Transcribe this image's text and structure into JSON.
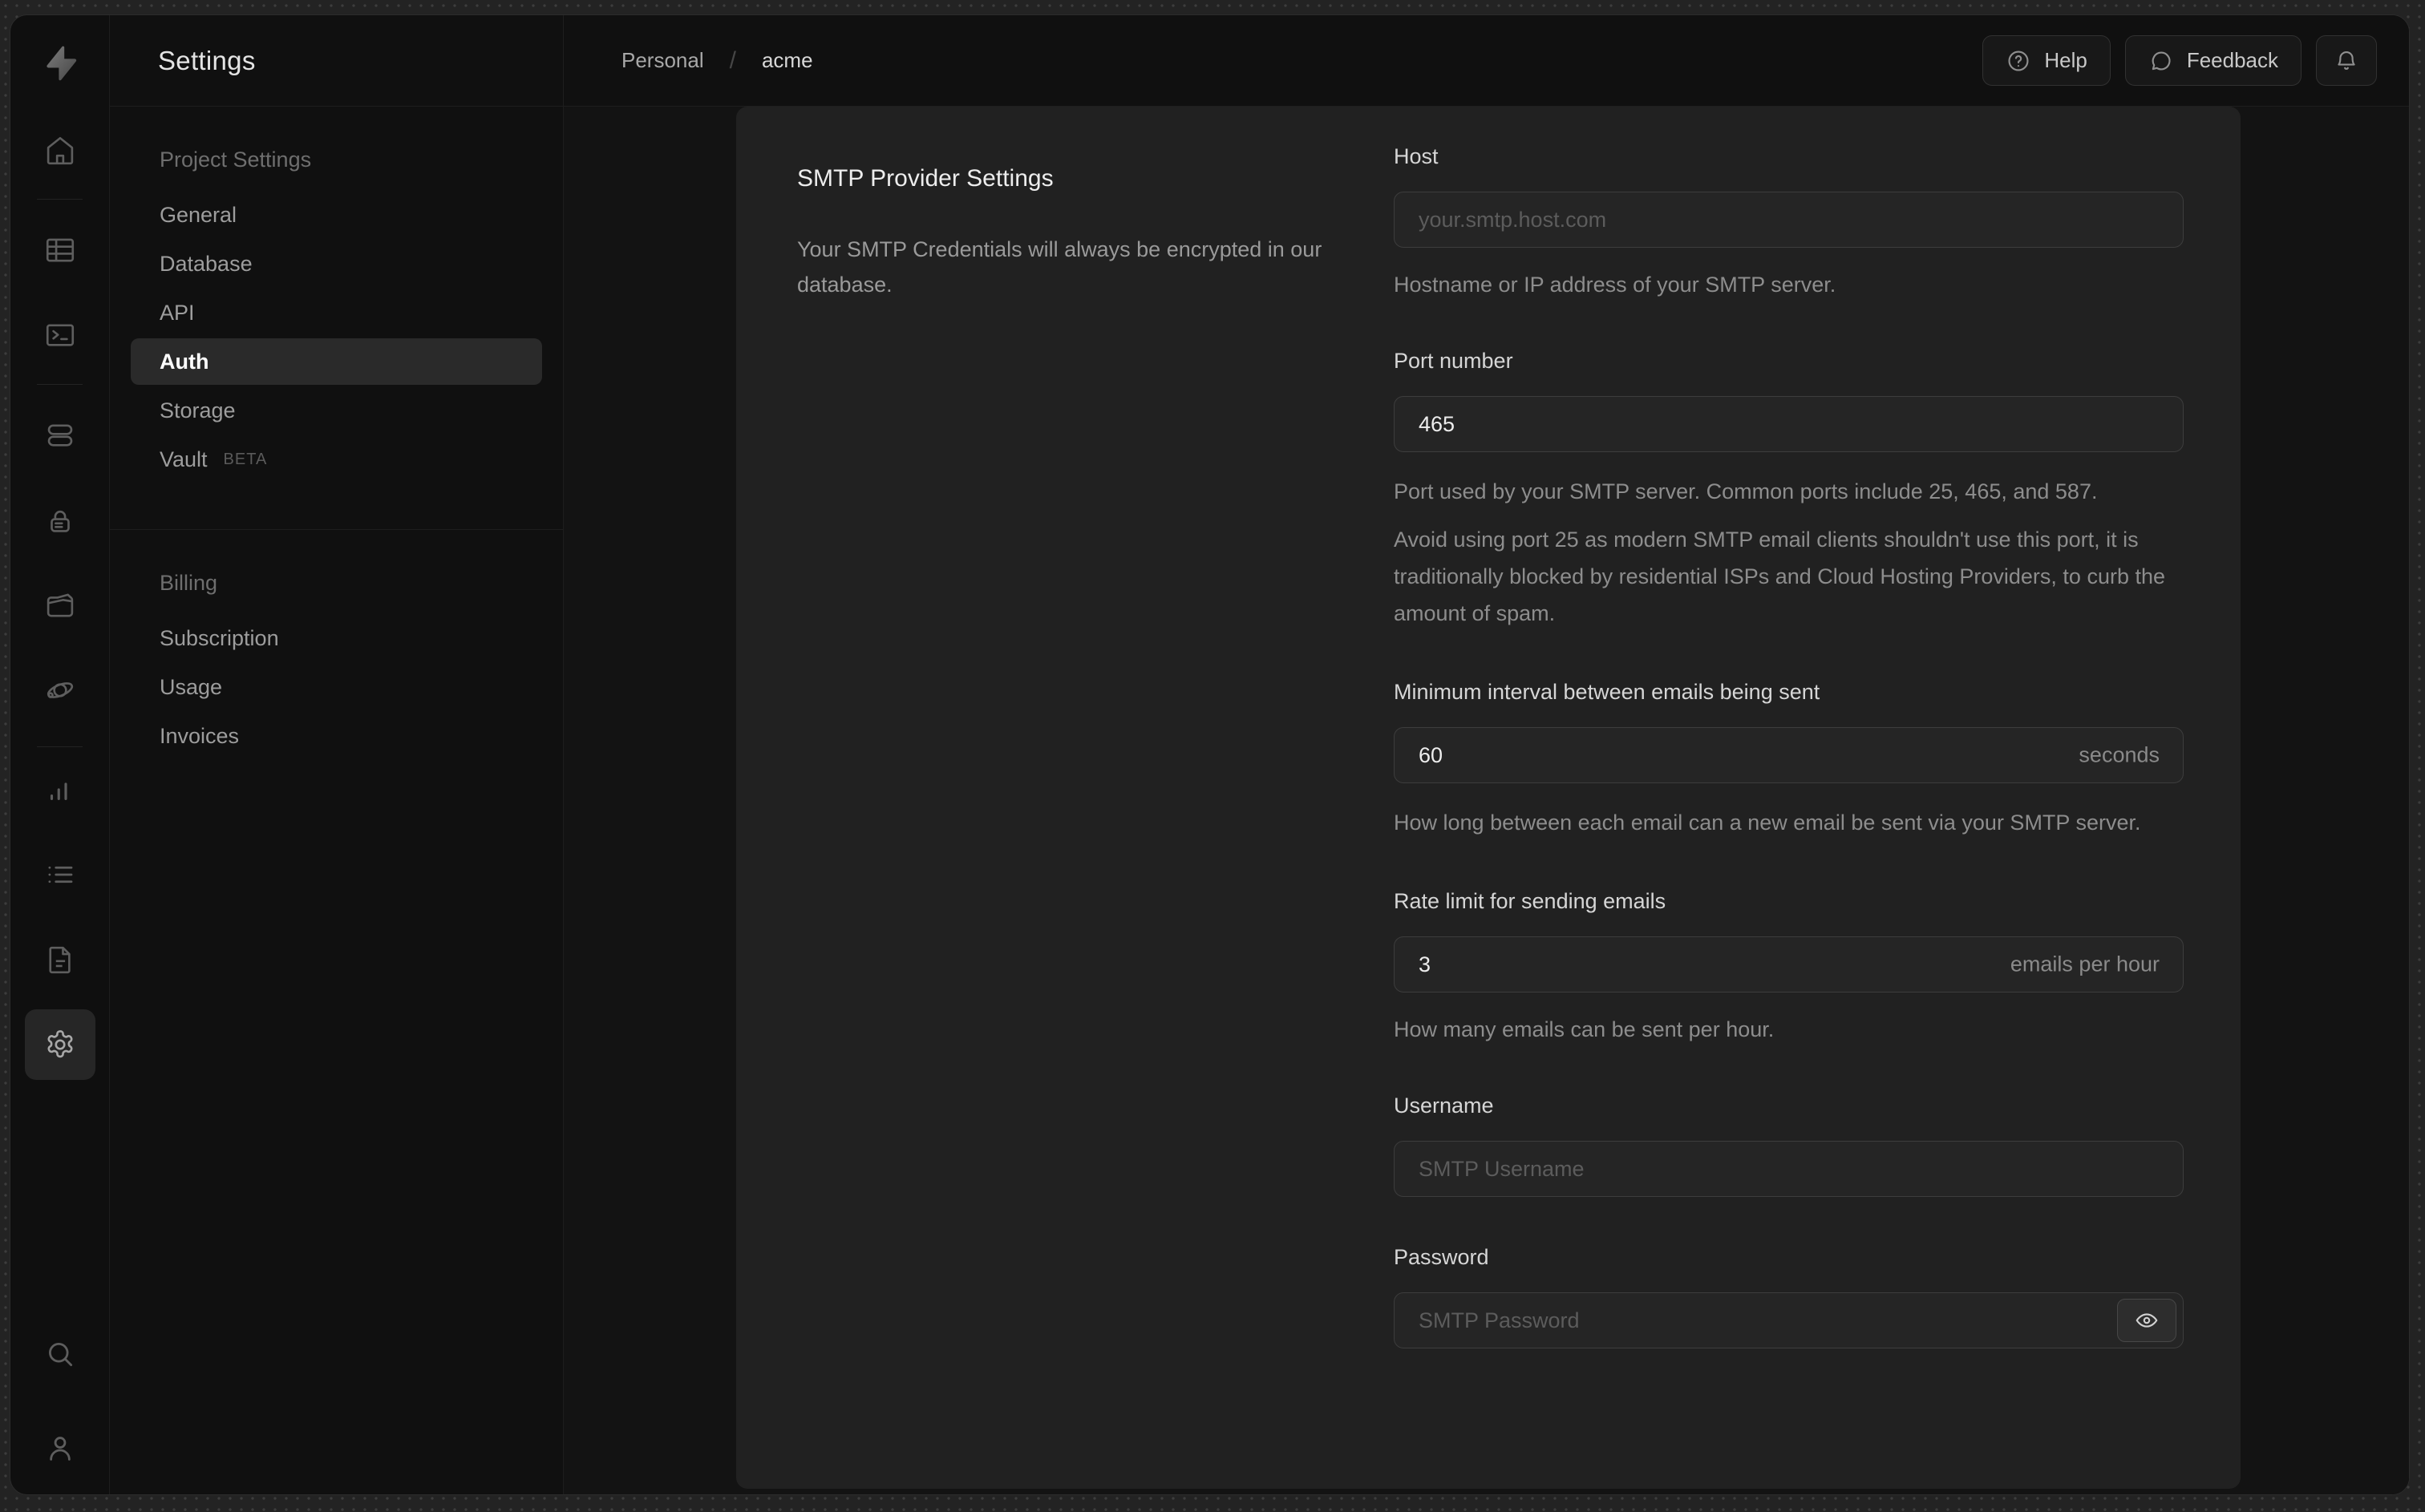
{
  "colors": {
    "desktop_background": "#232323",
    "window_background": "#0f0f0f",
    "panel_background": "#212121",
    "active_item_background": "#2a2a2a",
    "text_primary": "#ededed",
    "text_muted": "#8d8d8d"
  },
  "rail": {
    "items": [
      "home",
      "table-editor",
      "sql-editor",
      "database",
      "authentication",
      "storage",
      "edge-functions",
      "reports",
      "logs",
      "docs",
      "settings",
      "search",
      "profile"
    ],
    "active_item": "settings"
  },
  "sidebar": {
    "title": "Settings",
    "sections": [
      {
        "label": "Project Settings",
        "items": [
          {
            "label": "General"
          },
          {
            "label": "Database"
          },
          {
            "label": "API"
          },
          {
            "label": "Auth",
            "active": true
          },
          {
            "label": "Storage"
          },
          {
            "label": "Vault",
            "badge": "BETA"
          }
        ]
      },
      {
        "label": "Billing",
        "items": [
          {
            "label": "Subscription"
          },
          {
            "label": "Usage"
          },
          {
            "label": "Invoices"
          }
        ]
      }
    ]
  },
  "breadcrumb": {
    "org": "Personal",
    "separator": "/",
    "project": "acme"
  },
  "topbar": {
    "help_label": "Help",
    "feedback_label": "Feedback"
  },
  "panel": {
    "title": "SMTP Provider Settings",
    "description": "Your SMTP Credentials will always be encrypted in our database.",
    "fields": {
      "host": {
        "label": "Host",
        "placeholder": "your.smtp.host.com",
        "helper": "Hostname or IP address of your SMTP server."
      },
      "port": {
        "label": "Port number",
        "value": "465",
        "helper1": "Port used by your SMTP server. Common ports include 25, 465, and 587.",
        "helper2": "Avoid using port 25 as modern SMTP email clients shouldn't use this port, it is traditionally blocked by residential ISPs and Cloud Hosting Providers, to curb the amount of spam."
      },
      "interval": {
        "label": "Minimum interval between emails being sent",
        "value": "60",
        "suffix": "seconds",
        "helper": "How long between each email can a new email be sent via your SMTP server."
      },
      "rate": {
        "label": "Rate limit for sending emails",
        "value": "3",
        "suffix": "emails per hour",
        "helper": "How many emails can be sent per hour."
      },
      "username": {
        "label": "Username",
        "placeholder": "SMTP Username"
      },
      "password": {
        "label": "Password",
        "placeholder": "SMTP Password"
      }
    }
  }
}
